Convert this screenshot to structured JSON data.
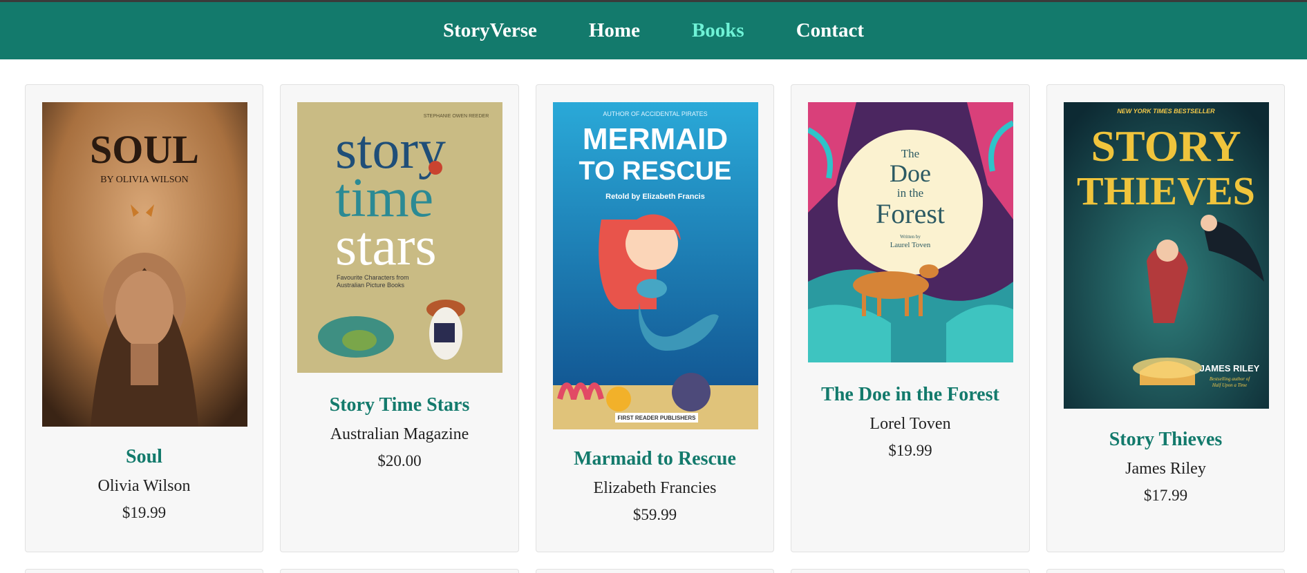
{
  "nav": {
    "brand": "StoryVerse",
    "links": [
      {
        "label": "Home",
        "active": false
      },
      {
        "label": "Books",
        "active": true
      },
      {
        "label": "Contact",
        "active": false
      }
    ]
  },
  "colors": {
    "navbar": "#137a6c",
    "active_link": "#6ff2d6",
    "title": "#137a6c"
  },
  "books": [
    {
      "title": "Soul",
      "author": "Olivia Wilson",
      "price": "$19.99",
      "cover": {
        "title_text": "SOUL",
        "byline": "BY OLIVIA WILSON"
      }
    },
    {
      "title": "Story Time Stars",
      "author": "Australian Magazine",
      "price": "$20.00",
      "cover": {
        "top_line": "STEPHANIE OWEN REEDER",
        "line1": "story",
        "line2": "time",
        "line3": "stars",
        "subtitle1": "Favourite Characters from",
        "subtitle2": "Australian Picture Books"
      }
    },
    {
      "title": "Marmaid to Rescue",
      "author": "Elizabeth Francies",
      "price": "$59.99",
      "cover": {
        "top_line": "AUTHOR OF ACCIDENTAL PIRATES",
        "line1": "MERMAID",
        "line2": "TO RESCUE",
        "retold": "Retold by Elizabeth Francis",
        "publisher": "FIRST READER PUBLISHERS"
      }
    },
    {
      "title": "The Doe in the Forest",
      "author": "Lorel Toven",
      "price": "$19.99",
      "cover": {
        "the": "The",
        "doe": "Doe",
        "in_the": "in the",
        "forest": "Forest",
        "written_by": "Written by",
        "author": "Laurel Toven"
      }
    },
    {
      "title": "Story Thieves",
      "author": "James Riley",
      "price": "$17.99",
      "cover": {
        "top_line": "NEW YORK TIMES BESTSELLER",
        "line1": "STORY",
        "line2": "THIEVES",
        "author": "JAMES RILEY",
        "tag1": "Bestselling author of",
        "tag2": "Half Upon a Time"
      }
    }
  ]
}
